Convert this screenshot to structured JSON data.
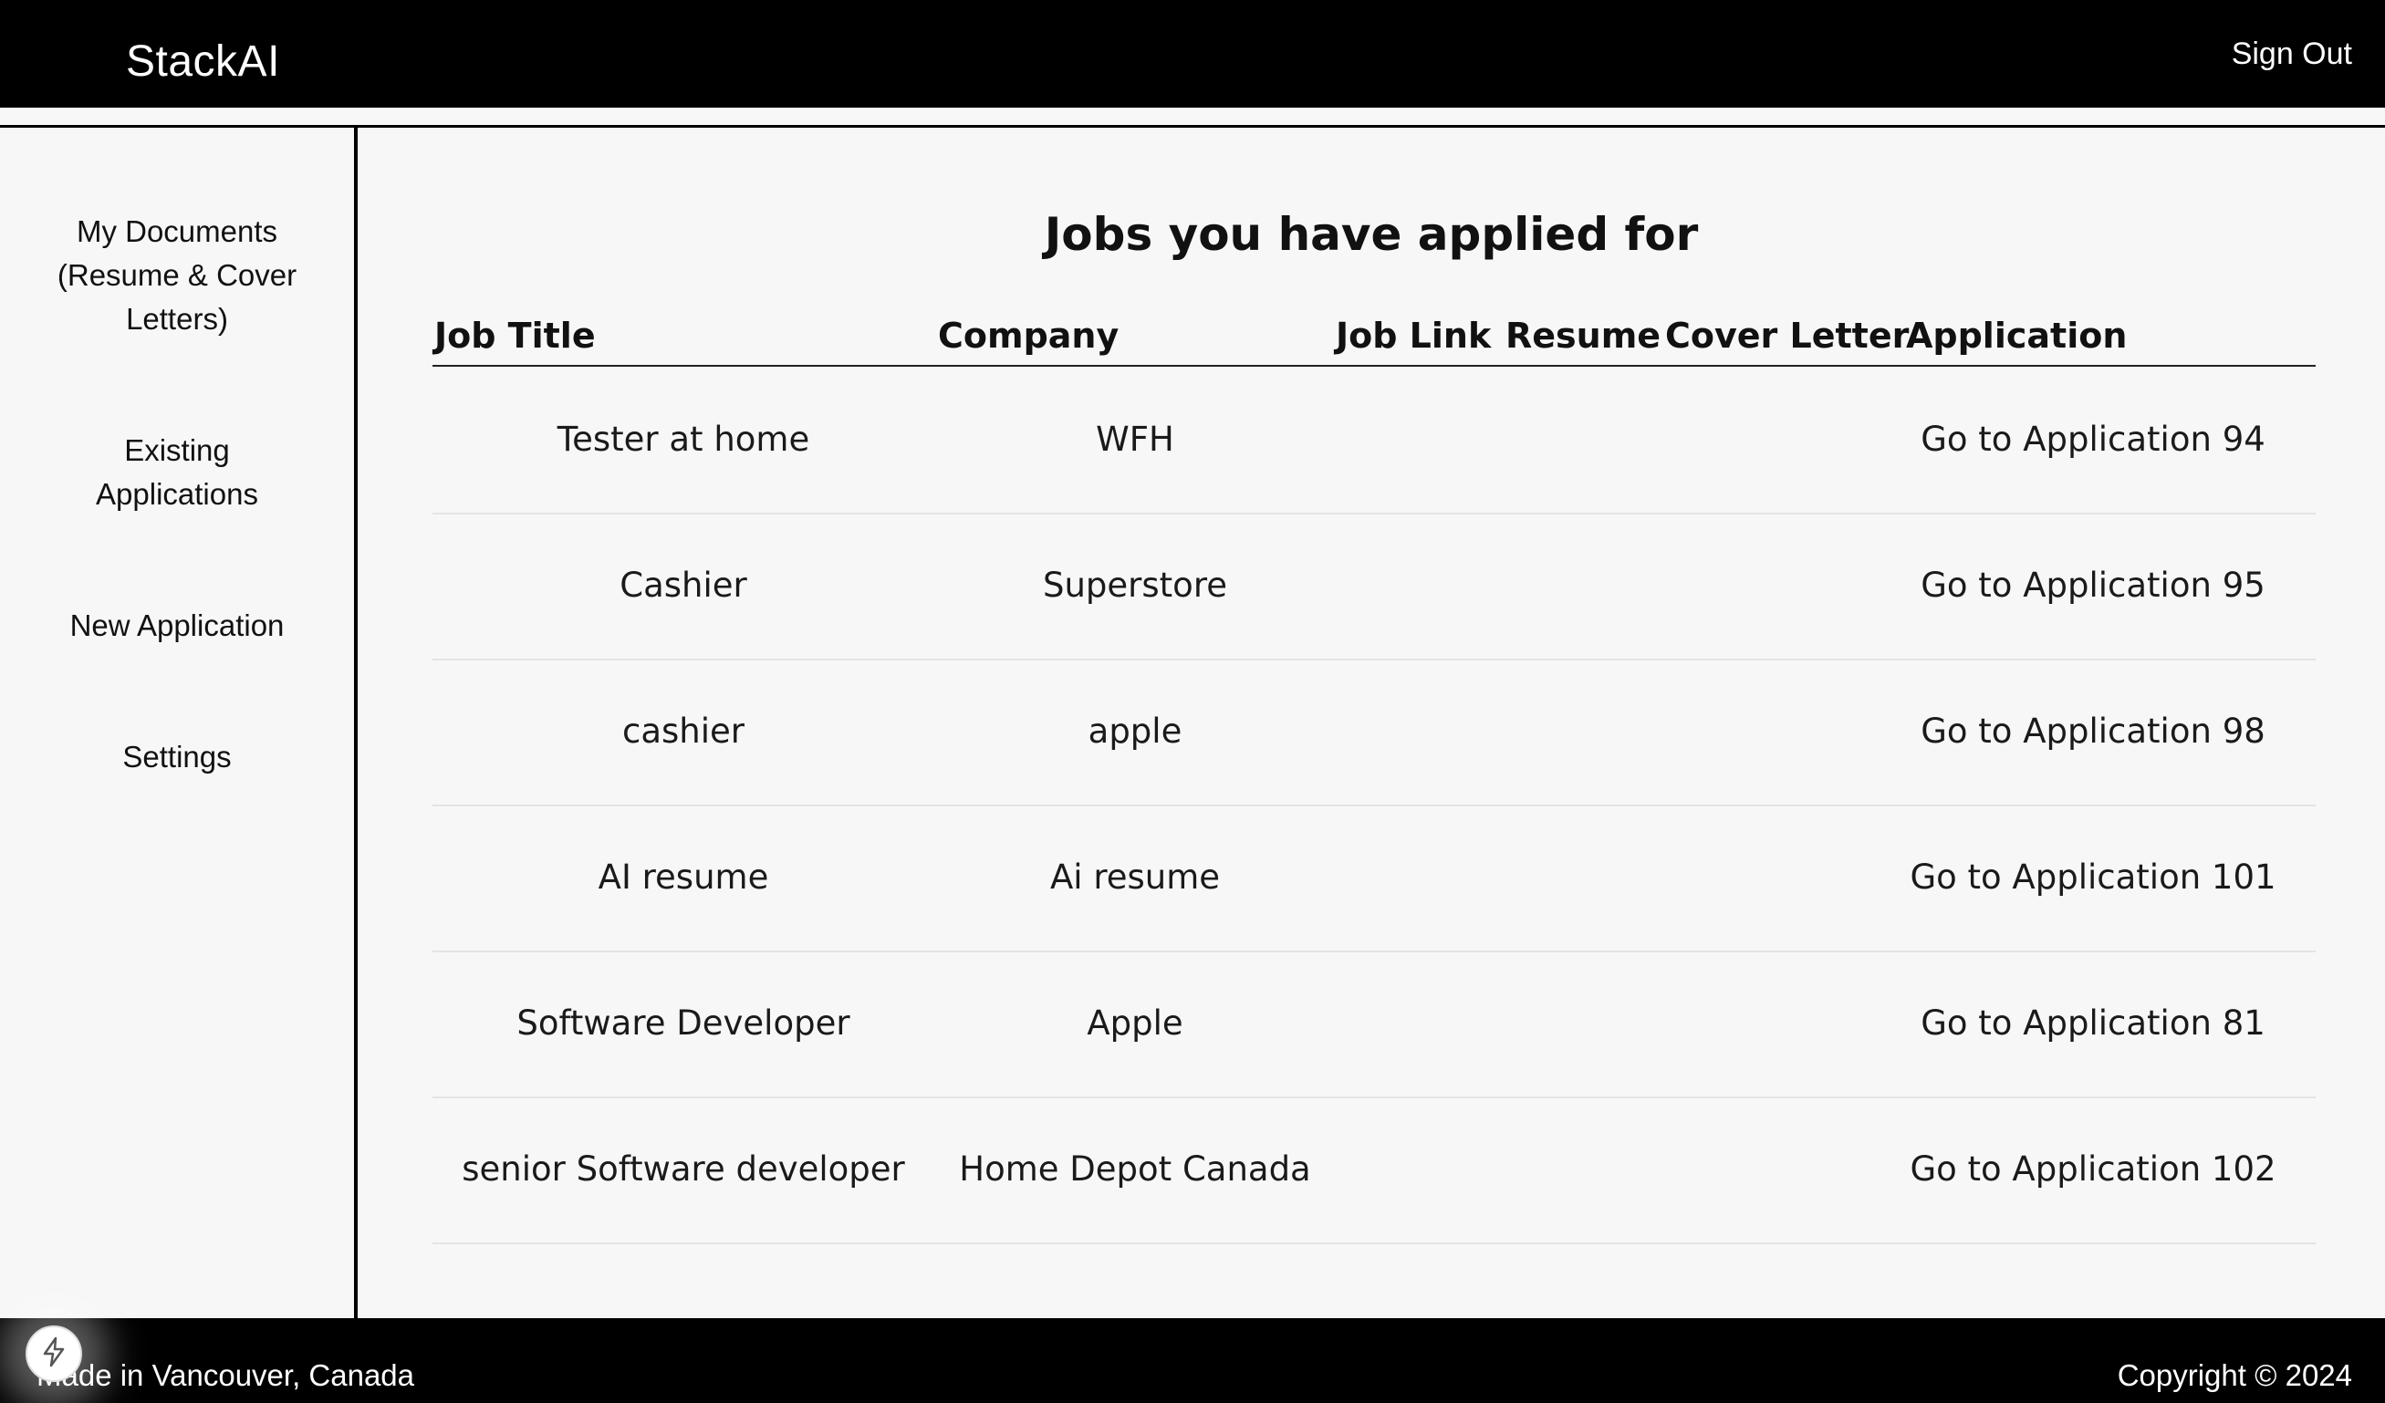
{
  "header": {
    "brand": "StackAI",
    "sign_out": "Sign Out"
  },
  "sidebar": {
    "items": [
      {
        "label": "My Documents (Resume & Cover Letters)"
      },
      {
        "label": "Existing Applications"
      },
      {
        "label": "New Application"
      },
      {
        "label": "Settings"
      }
    ]
  },
  "main": {
    "title": "Jobs you have applied for",
    "columns": {
      "job_title": "Job Title",
      "company": "Company",
      "job_link": "Job Link",
      "resume": "Resume",
      "cover_letter": "Cover Letter",
      "application": "Application"
    },
    "rows": [
      {
        "job_title": "Tester at home",
        "company": "WFH",
        "application": "Go to Application 94"
      },
      {
        "job_title": "Cashier",
        "company": "Superstore",
        "application": "Go to Application 95"
      },
      {
        "job_title": "cashier",
        "company": "apple",
        "application": "Go to Application 98"
      },
      {
        "job_title": "AI resume",
        "company": "Ai resume",
        "application": "Go to Application 101"
      },
      {
        "job_title": "Software Developer",
        "company": "Apple",
        "application": "Go to Application 81"
      },
      {
        "job_title": "senior Software developer",
        "company": "Home Depot Canada",
        "application": "Go to Application 102"
      }
    ]
  },
  "footer": {
    "left": "Made in Vancouver, Canada",
    "right": "Copyright © 2024"
  },
  "icons": {
    "fab": "bolt-icon"
  }
}
